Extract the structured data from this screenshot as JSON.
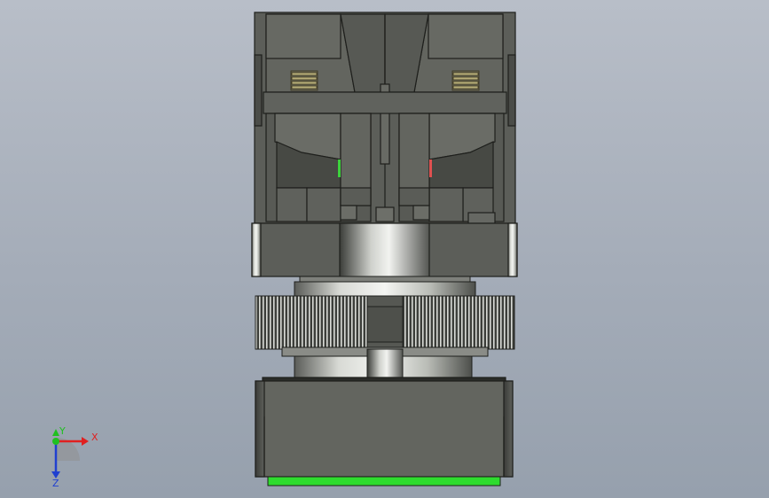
{
  "viewport": {
    "background_top": "#b8bec8",
    "background_bottom": "#96a0ad"
  },
  "model": {
    "body_color": "#5c5e59",
    "edge_color": "#1e1f1c",
    "metal_color": "#c9ccc6",
    "indicator_left": "#3cd23c",
    "indicator_right": "#e05050",
    "base_stripe": "#2edc2e"
  },
  "triad": {
    "x_label": "X",
    "y_label": "Y",
    "z_label": "Z",
    "x_color": "#e02020",
    "y_color": "#20c020",
    "z_color": "#2040d0"
  }
}
